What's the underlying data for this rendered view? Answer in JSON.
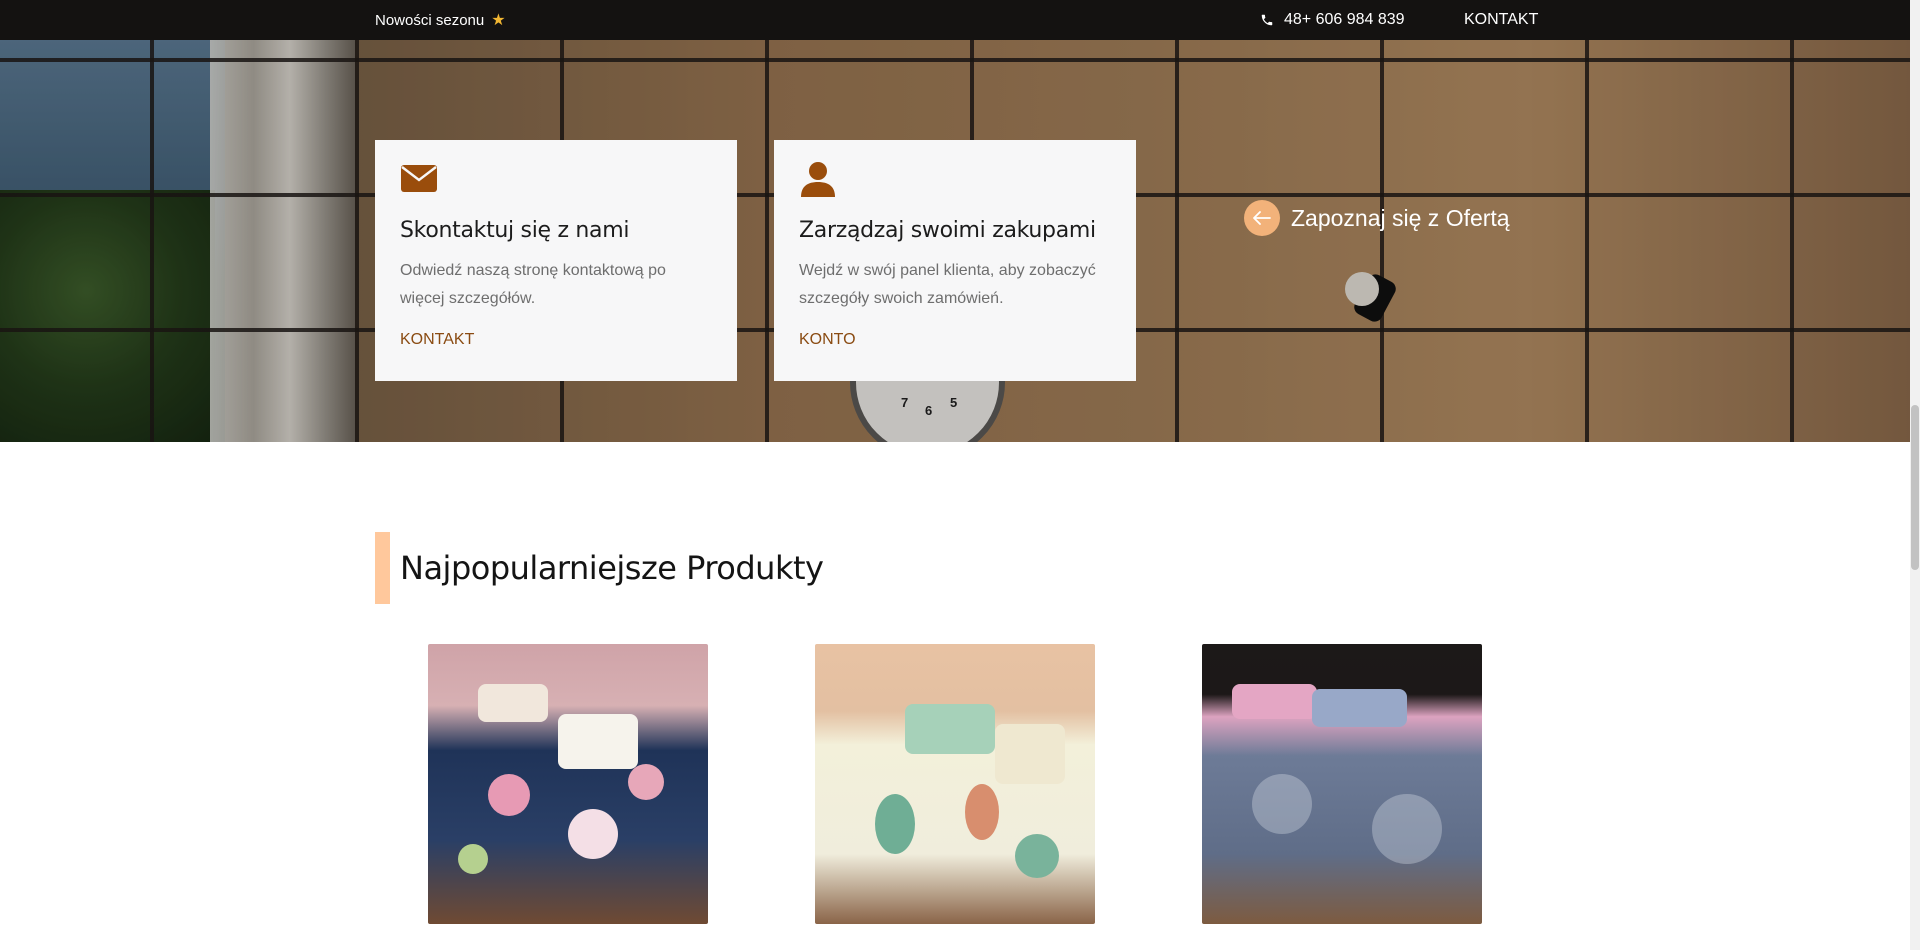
{
  "topbar": {
    "news_label": "Nowości sezonu",
    "star": "★",
    "phone": "48+ 606 984 839",
    "contact_label": "KONTAKT"
  },
  "hero": {
    "clock_numbers": [
      "7",
      "6",
      "5"
    ],
    "cards": [
      {
        "icon": "envelope-icon",
        "title": "Skontaktuj się z nami",
        "text": "Odwiedź naszą stronę kontaktową po więcej szczegółów.",
        "link": "KONTAKT"
      },
      {
        "icon": "user-icon",
        "title": "Zarządzaj swoimi zakupami",
        "text": "Wejdź w swój panel klienta, aby zobaczyć szczegóły swoich zamówień.",
        "link": "KONTO"
      }
    ],
    "offer_label": "Zapoznaj się z Ofertą"
  },
  "products_section": {
    "title": "Najpopularniejsze Produkty",
    "products": [
      {
        "image": "floral navy bedding"
      },
      {
        "image": "cream leaf pattern bedding"
      },
      {
        "image": "grey tree pattern bedding"
      }
    ]
  },
  "colors": {
    "accent_brown": "#8a4b12",
    "accent_peach": "#f2b27a",
    "title_bar": "#ffc89c",
    "topbar_bg": "#141211"
  }
}
